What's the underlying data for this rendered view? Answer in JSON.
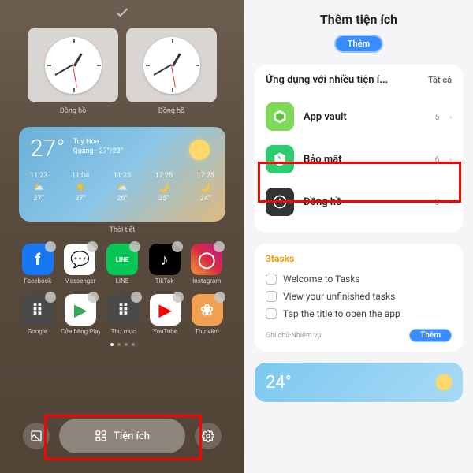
{
  "left": {
    "clock_label": "Đồng hồ",
    "weather": {
      "temp": "27°",
      "location": "Tuy Hoa",
      "detail": "Quang · 27°/23°",
      "widget_label": "Thời tiết",
      "hourly": [
        {
          "time": "11:23",
          "icon": "⛅",
          "temp": "27°"
        },
        {
          "time": "11:04",
          "icon": "☀️",
          "temp": "27°"
        },
        {
          "time": "11:23",
          "icon": "⛅",
          "temp": "26°"
        },
        {
          "time": "17:25",
          "icon": "🌙",
          "temp": "25°"
        },
        {
          "time": "17:25",
          "icon": "🌙",
          "temp": "24°"
        }
      ]
    },
    "apps_row1": [
      {
        "name": "Facebook",
        "bg": "#1877f2",
        "glyph": "f",
        "color": "#fff"
      },
      {
        "name": "Messenger",
        "bg": "#fff",
        "glyph": "💬",
        "color": "#a050ff"
      },
      {
        "name": "LINE",
        "bg": "#06c755",
        "glyph": "LINE",
        "color": "#fff"
      },
      {
        "name": "TikTok",
        "bg": "#000",
        "glyph": "♪",
        "color": "#fff"
      },
      {
        "name": "Instagram",
        "bg": "linear-gradient(45deg,#f09433,#e6683c,#dc2743,#cc2366,#bc1888)",
        "glyph": "◯",
        "color": "#fff"
      }
    ],
    "apps_row2": [
      {
        "name": "Google",
        "bg": "#4a4a4a",
        "glyph": "⠿",
        "color": "#fff"
      },
      {
        "name": "Cửa hàng Play",
        "bg": "#fff",
        "glyph": "▶",
        "color": "#34a853"
      },
      {
        "name": "Thư mục",
        "bg": "#4a4a4a",
        "glyph": "⠿",
        "color": "#fff"
      },
      {
        "name": "YouTube",
        "bg": "#fff",
        "glyph": "▶",
        "color": "#ff0000"
      },
      {
        "name": "Thư viện",
        "bg": "#f0a050",
        "glyph": "❀",
        "color": "#fff"
      }
    ],
    "widget_btn": "Tiện ích"
  },
  "right": {
    "title": "Thêm tiện ích",
    "add_label": "Thêm",
    "section1_heading": "Ứng dụng với nhiều tiện í...",
    "see_all": "Tất cả",
    "rows": [
      {
        "label": "App vault",
        "count": "5",
        "bg": "#7ed957"
      },
      {
        "label": "Bảo mật",
        "count": "6",
        "bg": "#2ecc71"
      },
      {
        "label": "Đồng hồ",
        "count": "3",
        "bg": "#333"
      }
    ],
    "tasks_heading": "3tasks",
    "tasks": [
      "Welcome to Tasks",
      "View your unfinished tasks",
      "Tap the title to open the app"
    ],
    "tasks_footer": "Ghi chú·Nhiệm vụ",
    "bottom_temp": "24°"
  }
}
